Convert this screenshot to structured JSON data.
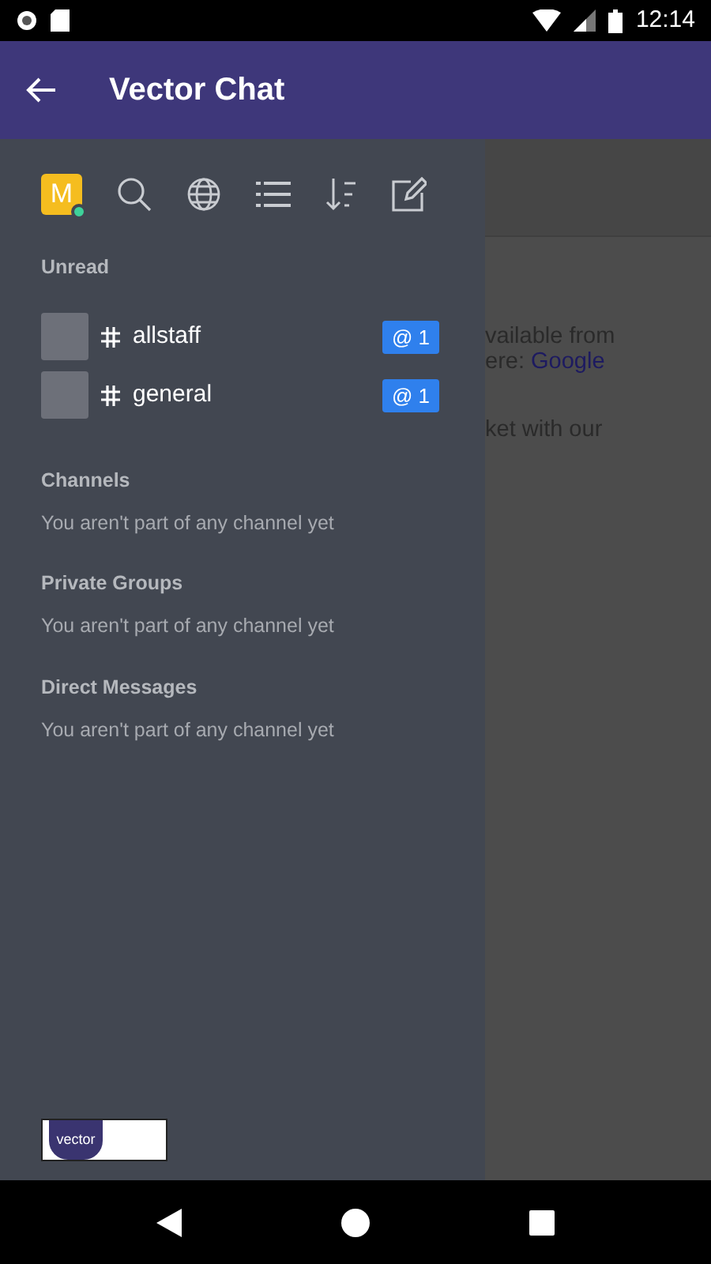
{
  "status_bar": {
    "time": "12:14"
  },
  "app_bar": {
    "title": "Vector Chat"
  },
  "drawer": {
    "user": {
      "initial": "M",
      "color": "#3ed29a"
    },
    "unread": {
      "title": "Unread",
      "rooms": [
        {
          "name": "allstaff",
          "badge": "@ 1"
        },
        {
          "name": "general",
          "badge": "@ 1"
        }
      ]
    },
    "sections": [
      {
        "title": "Channels",
        "empty_text": "You aren't part of any channel yet"
      },
      {
        "title": "Private Groups",
        "empty_text": "You aren't part of any channel yet"
      },
      {
        "title": "Direct Messages",
        "empty_text": "You aren't part of any channel yet"
      }
    ],
    "logo_text": "vector"
  },
  "background_content": [
    {
      "text": "vailable from"
    },
    {
      "text": "ere: ",
      "link": "Google"
    },
    {
      "text": "ket with our"
    }
  ]
}
